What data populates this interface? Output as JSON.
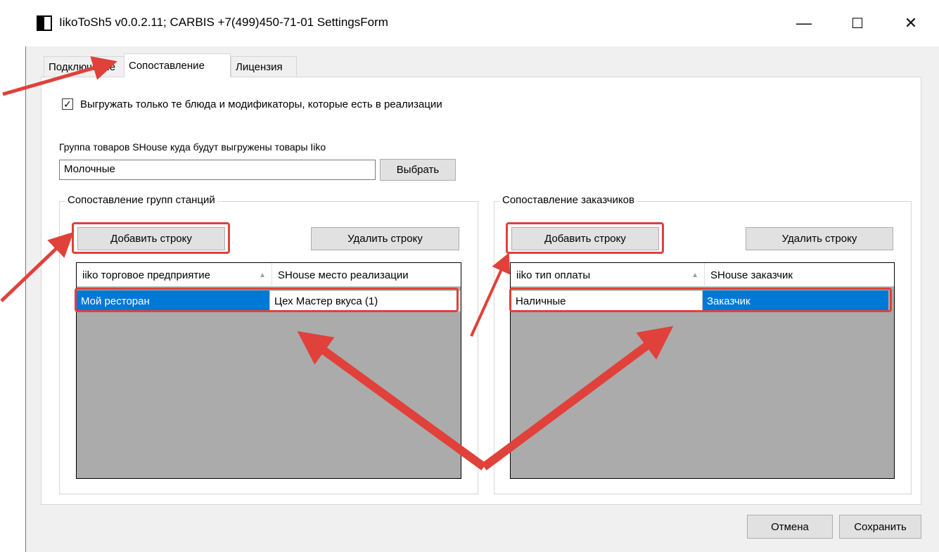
{
  "window": {
    "title": "IikoToSh5 v0.0.2.11;  CARBIS +7(499)450-71-01 SettingsForm",
    "controls": {
      "minimize": "—",
      "maximize": "☐",
      "close": "✕"
    }
  },
  "tabs": [
    {
      "label": "Подключение",
      "active": false
    },
    {
      "label": "Сопоставление",
      "active": true
    },
    {
      "label": "Лицензия",
      "active": false
    }
  ],
  "export_checkbox": {
    "checked": true,
    "mark": "✓",
    "label": "Выгружать только те блюда и модификаторы, которые есть в реализации"
  },
  "product_group": {
    "label": "Группа товаров SHouse куда будут выгружены товары Iiko",
    "value": "Молочные",
    "choose_button": "Выбрать"
  },
  "stations_group": {
    "caption": "Сопоставление групп станций",
    "add_button": "Добавить строку",
    "delete_button": "Удалить строку",
    "columns": [
      "iiko торговое предприятие",
      "SHouse место реализации"
    ],
    "rows": [
      [
        "Мой ресторан",
        "Цех Мастер вкуса (1)"
      ]
    ]
  },
  "customers_group": {
    "caption": "Сопоставление заказчиков",
    "add_button": "Добавить строку",
    "delete_button": "Удалить строку",
    "columns": [
      "iiko тип оплаты",
      "SHouse заказчик"
    ],
    "rows": [
      [
        "Наличные",
        "Заказчик"
      ]
    ]
  },
  "footer": {
    "cancel_button": "Отмена",
    "save_button": "Сохранить"
  },
  "colors": {
    "selection": "#0078d7",
    "annotation": "#e0413a",
    "grid_bg": "#ababab"
  },
  "sort_arrow": "▲"
}
